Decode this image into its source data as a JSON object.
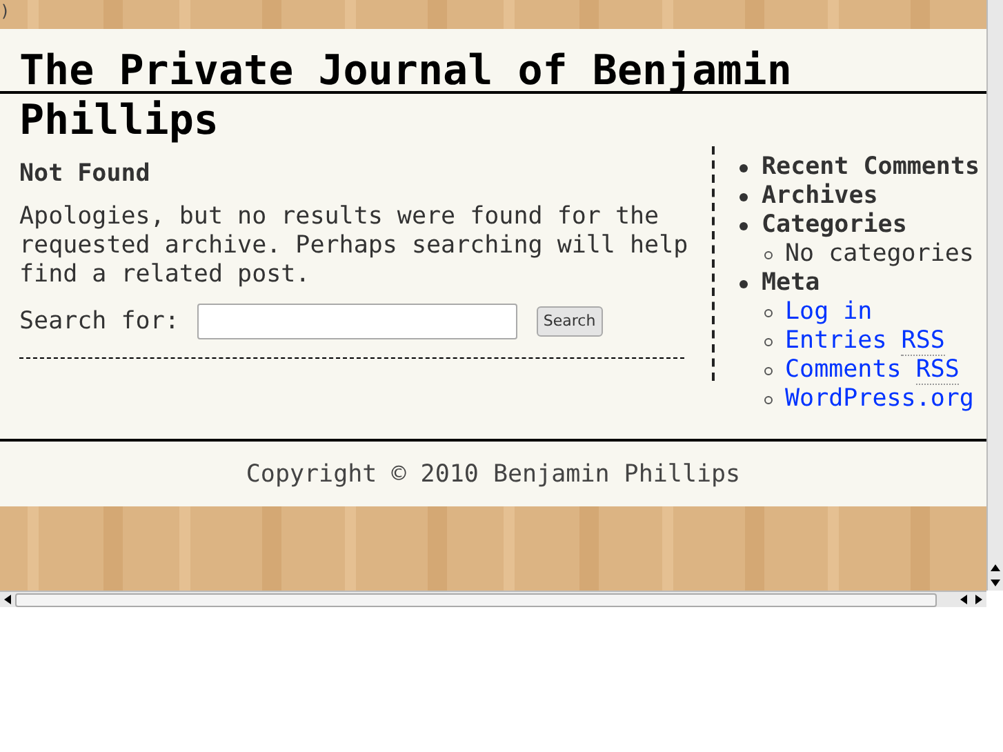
{
  "corner_text": ")",
  "site_title": "The Private Journal of Benjamin Phillips",
  "content": {
    "heading": "Not Found",
    "message": "Apologies, but no results were found for the requested archive. Perhaps searching will help find a related post.",
    "search": {
      "label": "Search for:",
      "button": "Search"
    }
  },
  "sidebar": [
    {
      "kind": "heading",
      "text": "Recent Comments"
    },
    {
      "kind": "heading",
      "text": "Archives"
    },
    {
      "kind": "heading",
      "text": "Categories",
      "children": [
        {
          "kind": "text",
          "text": "No categories"
        }
      ]
    },
    {
      "kind": "heading",
      "text": "Meta",
      "children": [
        {
          "kind": "link",
          "parts": [
            "Log in"
          ]
        },
        {
          "kind": "link",
          "parts": [
            "Entries ",
            "RSS"
          ]
        },
        {
          "kind": "link",
          "parts": [
            "Comments ",
            "RSS"
          ]
        },
        {
          "kind": "link",
          "parts": [
            "WordPress.org"
          ]
        }
      ]
    }
  ],
  "footer": "Copyright © 2010 Benjamin Phillips"
}
